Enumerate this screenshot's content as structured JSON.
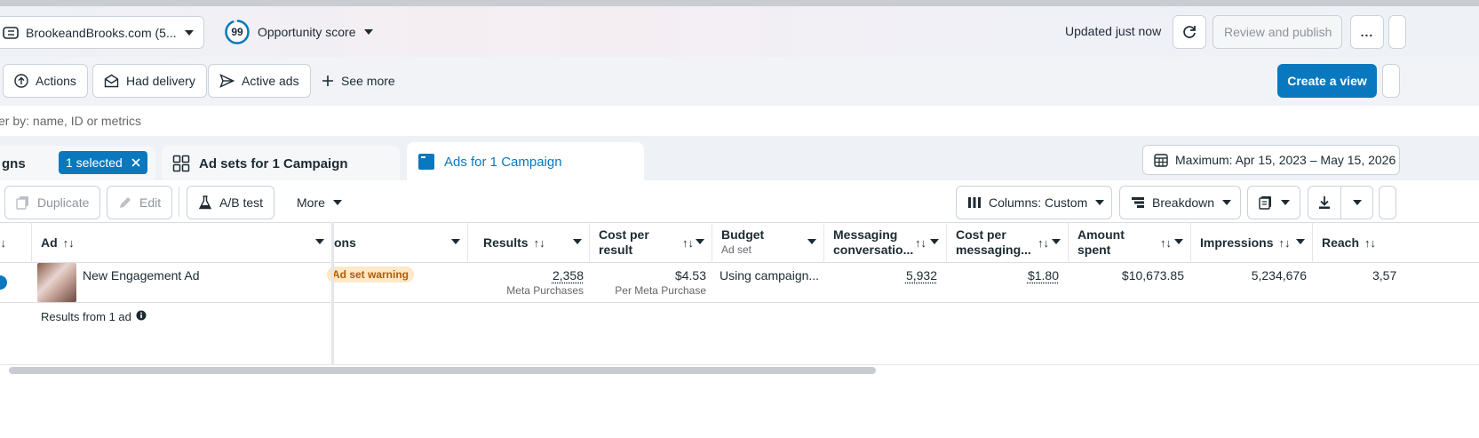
{
  "header": {
    "account_name": "BrookeandBrooks.com (5...",
    "opportunity_score": "99",
    "opportunity_label": "Opportunity score",
    "updated_text": "Updated just now",
    "review_publish_label": "Review and publish",
    "more_label": "..."
  },
  "filters": {
    "actions_label": "Actions",
    "had_delivery_label": "Had delivery",
    "active_ads_label": "Active ads",
    "see_more_label": "See more",
    "create_view_label": "Create a view",
    "search_placeholder": "er by: name, ID or metrics"
  },
  "tabs": {
    "campaigns_label": "gns",
    "selected_label": "1 selected",
    "adsets_label": "Ad sets for 1 Campaign",
    "ads_label": "Ads for 1 Campaign",
    "date_range": "Maximum: Apr 15, 2023 – May 15, 2026"
  },
  "table_toolbar": {
    "duplicate_label": "Duplicate",
    "edit_label": "Edit",
    "ab_test_label": "A/B test",
    "more_label": "More",
    "columns_label": "Columns: Custom",
    "breakdown_label": "Breakdown"
  },
  "columns": {
    "ad": "Ad",
    "ons": "ons",
    "results": "Results",
    "cost_per_result_1": "Cost per",
    "cost_per_result_2": "result",
    "budget": "Budget",
    "budget_sub": "Ad set",
    "messaging_1": "Messaging",
    "messaging_2": "conversatio...",
    "cost_msg_1": "Cost per",
    "cost_msg_2": "messaging...",
    "amount_1": "Amount",
    "amount_2": "spent",
    "impressions": "Impressions",
    "reach": "Reach"
  },
  "row": {
    "ad_name": "New Engagement Ad",
    "warning": "Ad set warning",
    "results": "2,358",
    "results_sub": "Meta Purchases",
    "cost_per_result": "$4.53",
    "cost_per_result_sub": "Per Meta Purchase",
    "budget": "Using campaign...",
    "messaging": "5,932",
    "cost_msg": "$1.80",
    "amount_spent": "$10,673.85",
    "impressions": "5,234,676",
    "reach": "3,57"
  },
  "summary": {
    "results_from": "Results from 1 ad"
  },
  "colors": {
    "primary": "#0a78be",
    "warning_bg": "#fde8c8",
    "warning_text": "#b35c00"
  }
}
